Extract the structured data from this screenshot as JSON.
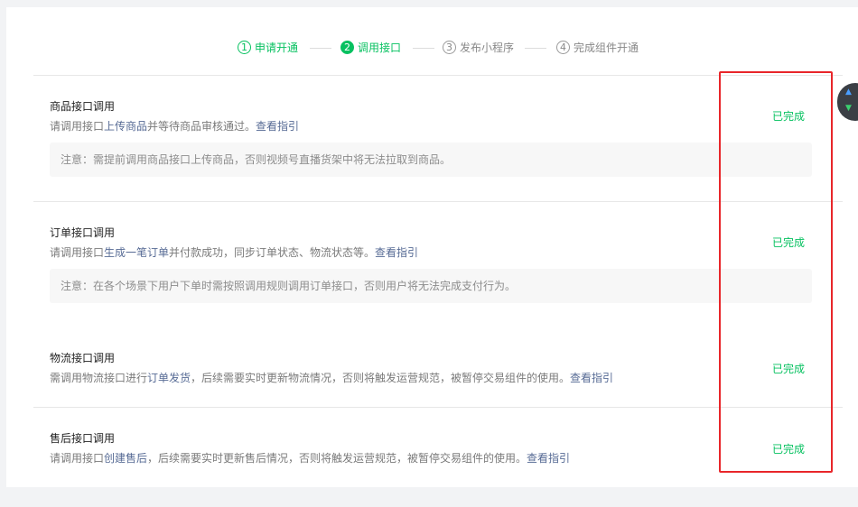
{
  "steps": [
    {
      "num": "1",
      "label": "申请开通",
      "state": "done"
    },
    {
      "num": "2",
      "label": "调用接口",
      "state": "active"
    },
    {
      "num": "3",
      "label": "发布小程序",
      "state": "pending"
    },
    {
      "num": "4",
      "label": "完成组件开通",
      "state": "pending"
    }
  ],
  "sections": [
    {
      "title": "商品接口调用",
      "desc_prefix": "请调用接口",
      "desc_link": "上传商品",
      "desc_middle": "并等待商品审核通过。",
      "desc_guide": "查看指引",
      "note": "注意：需提前调用商品接口上传商品，否则视频号直播货架中将无法拉取到商品。",
      "status": "已完成"
    },
    {
      "title": "订单接口调用",
      "desc_prefix": "请调用接口",
      "desc_link": "生成一笔订单",
      "desc_middle": "并付款成功，同步订单状态、物流状态等。",
      "desc_guide": "查看指引",
      "note": "注意：在各个场景下用户下单时需按照调用规则调用订单接口，否则用户将无法完成支付行为。",
      "status": "已完成"
    },
    {
      "title": "物流接口调用",
      "desc_prefix": "需调用物流接口进行",
      "desc_link": "订单发货",
      "desc_middle": "，后续需要实时更新物流情况，否则将触发运营规范，被暂停交易组件的使用。",
      "desc_guide": "查看指引",
      "status": "已完成"
    },
    {
      "title": "售后接口调用",
      "desc_prefix": "请调用接口",
      "desc_link": "创建售后",
      "desc_middle": "，后续需要实时更新售后情况，否则将触发运营规范，被暂停交易组件的使用。",
      "desc_guide": "查看指引",
      "status": "已完成"
    }
  ],
  "colors": {
    "accent": "#07c160",
    "link": "#576b95",
    "highlight": "#e8262a"
  },
  "widget": {
    "up_icon": "arrow-up-icon",
    "down_icon": "arrow-down-icon"
  }
}
